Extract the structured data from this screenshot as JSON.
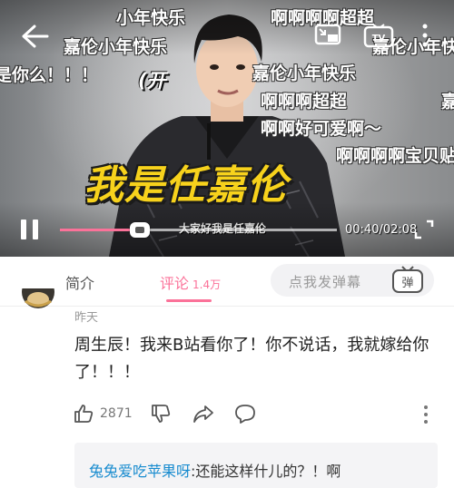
{
  "player": {
    "danmaku": [
      "小年快乐",
      "啊啊啊啊超超",
      "嘉伦小年快乐",
      "嘉伦小年快乐",
      "是你么！！！",
      "嘉伦小年快乐",
      "啊啊啊超超",
      "嘉",
      "啊啊好可爱啊～",
      "啊啊啊啊宝贝贴贴"
    ],
    "paren_text": "(开",
    "caption": "我是任嘉伦",
    "subcaption": "大家好我是任嘉伦",
    "time": "00:40/02:08",
    "progress": 0.29
  },
  "tabs": {
    "intro": "简介",
    "comments": "评论",
    "comments_count": "1.4万"
  },
  "danmu": {
    "placeholder": "点我发弹幕",
    "button_label": "弹"
  },
  "comment": {
    "date": "昨天",
    "text": "周生辰！我来B站看你了！你不说话，我就嫁给你了！！！",
    "likes": "2871"
  },
  "reply": {
    "user": "兔兔爱吃苹果呀",
    "text": ":还能这样什儿的？！啊"
  },
  "colors": {
    "accent": "#fb7299",
    "link": "#178bcf",
    "caption": "#f7d21c"
  }
}
